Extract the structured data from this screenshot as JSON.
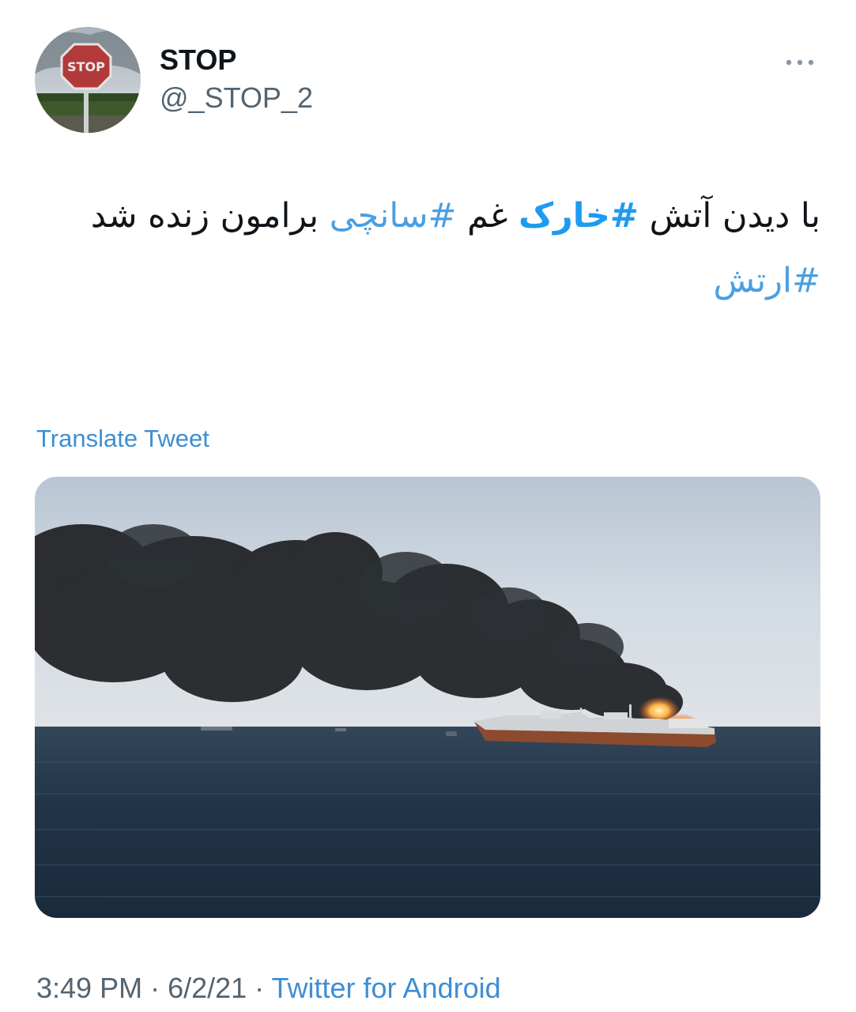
{
  "author": {
    "name": "STOP",
    "handle": "@_STOP_2",
    "avatar_icon": "stop-sign-avatar"
  },
  "tweet": {
    "line1_part1": "با دیدن آتش ",
    "hashtag_khark": "#خارک",
    "line1_part2": " غم ",
    "hashtag_sanchi": "#سانچی",
    "line1_part3": " برامون زنده شد",
    "hashtag_artesh": "#ارتش"
  },
  "translate_label": "Translate Tweet",
  "meta": {
    "time": "3:49 PM",
    "separator": " · ",
    "date": "6/2/21",
    "source": "Twitter for Android"
  },
  "colors": {
    "link": "#1d9bf0",
    "text": "#0f1419",
    "secondary": "#536471"
  }
}
